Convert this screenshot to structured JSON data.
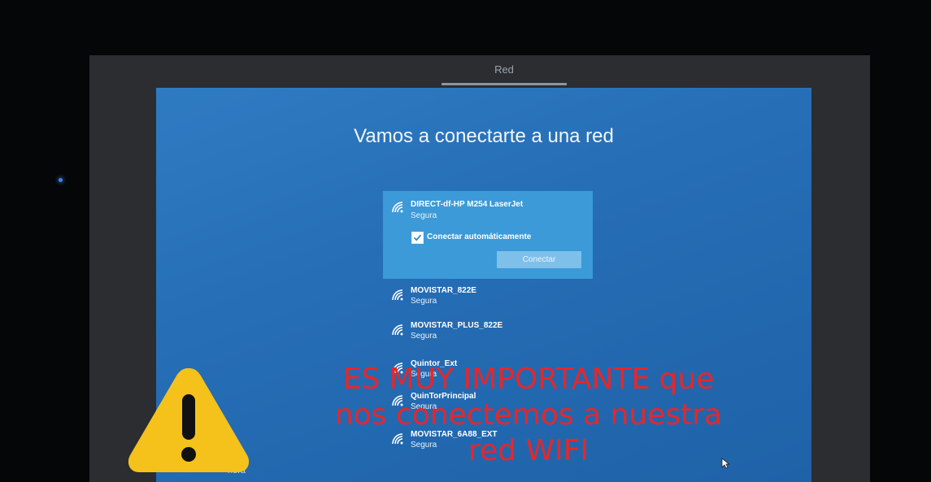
{
  "window": {
    "title": "Red"
  },
  "page": {
    "title": "Vamos a conectarte a una red"
  },
  "selected_network": {
    "name": "DIRECT-df-HP M254 LaserJet",
    "status": "Segura",
    "auto_connect_label": "Conectar automáticamente",
    "auto_connect_checked": true,
    "connect_label": "Conectar"
  },
  "networks": [
    {
      "name": "MOVISTAR_822E",
      "status": "Segura"
    },
    {
      "name": "MOVISTAR_PLUS_822E",
      "status": "Segura"
    },
    {
      "name": "Quintor_Ext",
      "status": "Segura"
    },
    {
      "name": "QuinTorPrincipal",
      "status": "Segura"
    },
    {
      "name": "MOVISTAR_6A88_EXT",
      "status": "Segura"
    }
  ],
  "bottom_left": {
    "text": "nora"
  },
  "overlay": {
    "line1": "ES MUY IMPORTANTE que",
    "line2": "nos conectemos a nuestra",
    "line3": "red WIFI",
    "color": "#e7262a"
  },
  "icons": {
    "wifi": "wifi-icon",
    "warning": "warning-icon",
    "cursor": "mouse-cursor-icon"
  },
  "colors": {
    "screen_bg": "#256db5",
    "selected_bg": "#3c9ad8",
    "button_bg": "#7fc0ea"
  }
}
